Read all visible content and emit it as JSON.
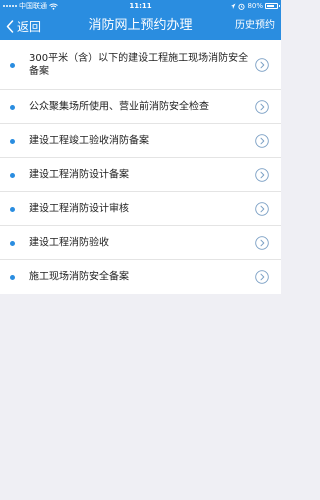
{
  "status_bar": {
    "carrier": "中国联通",
    "time": "11:11",
    "battery": "80%",
    "battery_level": 0.8,
    "wifi_icon": "wifi-icon",
    "alarm_icon": "alarm-icon"
  },
  "nav": {
    "back_label": "返回",
    "title": "消防网上预约办理",
    "history_label": "历史预约"
  },
  "items": [
    {
      "label": "300平米（含）以下的建设工程施工现场消防安全备案"
    },
    {
      "label": "公众聚集场所使用、营业前消防安全检查"
    },
    {
      "label": "建设工程竣工验收消防备案"
    },
    {
      "label": "建设工程消防设计备案"
    },
    {
      "label": "建设工程消防设计审核"
    },
    {
      "label": "建设工程消防验收"
    },
    {
      "label": "施工现场消防安全备案"
    }
  ],
  "colors": {
    "accent": "#2a8de0",
    "background": "#efeff4",
    "text": "#222222"
  }
}
